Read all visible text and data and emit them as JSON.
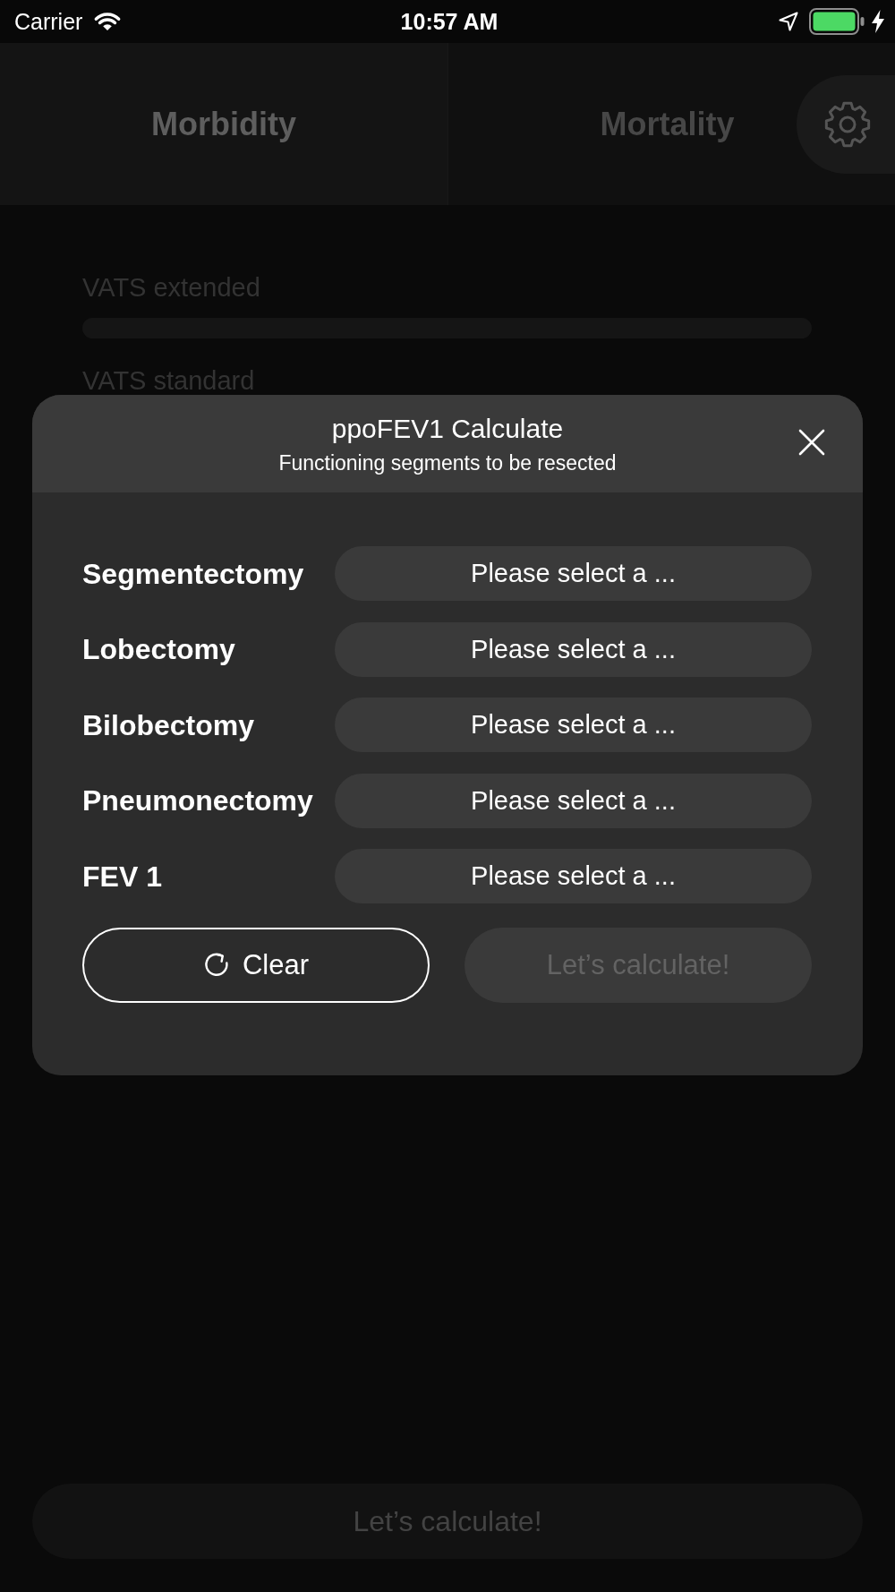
{
  "status_bar": {
    "carrier": "Carrier",
    "time": "10:57 AM"
  },
  "tabs": [
    {
      "label": "Morbidity",
      "selected": true
    },
    {
      "label": "Mortality",
      "selected": false
    }
  ],
  "form": [
    {
      "kind": "heading",
      "text": "VATS extended"
    },
    {
      "kind": "track"
    },
    {
      "kind": "heading",
      "text": "VATS standard"
    }
  ],
  "dialog": {
    "title": "ppoFEV1 Calculate",
    "subtitle": "Functioning segments to be resected",
    "rows": [
      {
        "label": "Segmentectomy",
        "placeholder": "Please select a ..."
      },
      {
        "label": "Lobectomy",
        "placeholder": "Please select a ..."
      },
      {
        "label": "Bilobectomy",
        "placeholder": "Please select a ..."
      },
      {
        "label": "Pneumonectomy",
        "placeholder": "Please select a ..."
      },
      {
        "label": "FEV 1",
        "placeholder": "Please select a ..."
      }
    ],
    "buttons": [
      {
        "kind": "reset",
        "label": "Clear",
        "disabled": false
      },
      {
        "kind": "submit",
        "label": "Let’s calculate!",
        "disabled": true
      }
    ]
  },
  "footer_button": {
    "label": "Let’s calculate!",
    "disabled": true
  }
}
